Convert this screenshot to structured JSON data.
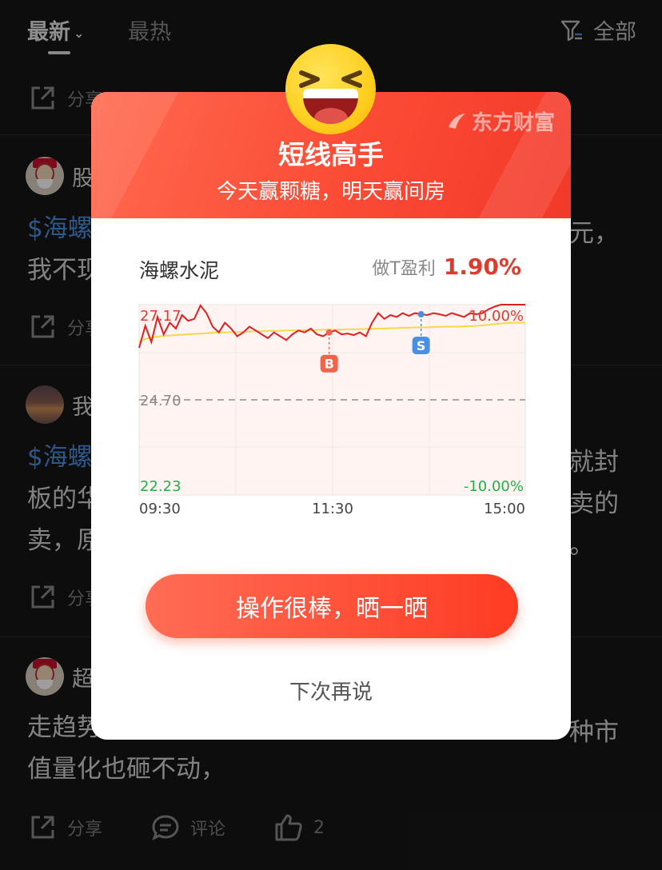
{
  "feed": {
    "tabs": [
      {
        "label": "最新",
        "active": true
      },
      {
        "label": "最热",
        "active": false
      }
    ],
    "filter_label": "全部",
    "actions": {
      "share": "分享",
      "comment": "评论",
      "like_count": "2"
    },
    "posts": [
      {
        "user": "股",
        "line1_tag": "$海螺",
        "line1_tail": "元，",
        "line2": "我不现"
      },
      {
        "user": "我",
        "line1_tag": "$海螺",
        "line1_tail": "就封",
        "line2": "板的华",
        "line2_tail": "卖的",
        "line3": "卖，原",
        "line3_tail": "。"
      },
      {
        "user": "超",
        "line1": "走趋势",
        "line1_tail": "种市",
        "line2": "值量化也砸不动，"
      }
    ]
  },
  "modal": {
    "brand": "东方财富",
    "title": "短线高手",
    "subtitle": "今天赢颗糖，明天赢间房",
    "stock_name": "海螺水泥",
    "profit_label": "做T盈利",
    "profit_value": "1.90%",
    "cta_label": "操作很棒，晒一晒",
    "later_label": "下次再说"
  },
  "chart_data": {
    "type": "line",
    "title": "",
    "y_high_label": "27.17",
    "y_mid_label": "24.70",
    "y_low_label": "22.23",
    "pct_high_label": "10.00%",
    "pct_low_label": "-10.00%",
    "x_tick_labels": [
      "09:30",
      "11:30",
      "15:00"
    ],
    "ylim": [
      22.23,
      27.17
    ],
    "prev_close": 24.7,
    "series": [
      {
        "name": "price",
        "color": "#e02020",
        "values": [
          26.05,
          26.62,
          26.2,
          26.85,
          26.4,
          26.7,
          26.55,
          26.9,
          26.75,
          26.8,
          27.15,
          26.95,
          26.6,
          26.45,
          26.7,
          26.55,
          26.35,
          26.45,
          26.6,
          26.5,
          26.4,
          26.3,
          26.45,
          26.35,
          26.25,
          26.4,
          26.5,
          26.45,
          26.55,
          26.4,
          26.35,
          26.45,
          26.5,
          26.4,
          26.42,
          26.38,
          26.45,
          26.35,
          26.7,
          26.95,
          26.8,
          26.9,
          26.85,
          26.95,
          26.88,
          26.95,
          26.92,
          26.9,
          26.95,
          26.92,
          26.88,
          26.95,
          26.9,
          26.85,
          26.95,
          26.92,
          26.95,
          27.05,
          27.12,
          27.17,
          27.17,
          27.17,
          27.17,
          27.17
        ]
      },
      {
        "name": "avg",
        "color": "#f5d94a",
        "values": [
          26.2,
          26.28,
          26.32,
          26.34,
          26.36,
          26.37,
          26.38,
          26.39,
          26.4,
          26.41,
          26.42,
          26.43,
          26.44,
          26.45,
          26.45,
          26.46,
          26.46,
          26.47,
          26.47,
          26.48,
          26.48,
          26.49,
          26.49,
          26.49,
          26.5,
          26.5,
          26.5,
          26.51,
          26.51,
          26.51,
          26.52,
          26.52,
          26.52,
          26.52,
          26.53,
          26.53,
          26.53,
          26.54,
          26.54,
          26.55,
          26.55,
          26.56,
          26.56,
          26.57,
          26.57,
          26.58,
          26.58,
          26.58,
          26.59,
          26.59,
          26.6,
          26.6,
          26.6,
          26.61,
          26.61,
          26.62,
          26.63,
          26.65,
          26.67,
          26.68,
          26.69,
          26.7,
          26.7,
          26.7
        ]
      }
    ],
    "markers": [
      {
        "label": "B",
        "index": 31,
        "value": 26.45,
        "color": "#f0644c"
      },
      {
        "label": "S",
        "index": 46,
        "value": 26.92,
        "color": "#4a90e2"
      }
    ]
  }
}
